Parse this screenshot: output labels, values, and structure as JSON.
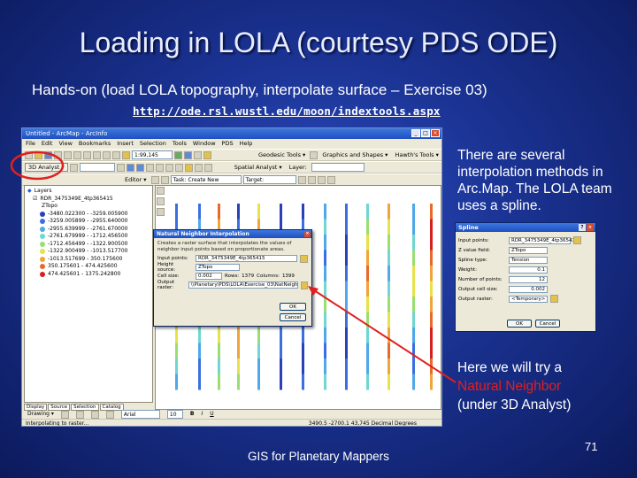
{
  "slide": {
    "title": "Loading in LOLA (courtesy PDS ODE)",
    "subtitle": "Hands-on (load LOLA topography, interpolate surface – Exercise 03)",
    "url": "http://ode.rsl.wustl.edu/moon/indextools.aspx",
    "note1": "There are several interpolation methods in Arc.Map. The LOLA team uses a spline.",
    "note2_pre": "Here we will try a",
    "note2_highlight": "Natural Neighbor",
    "note2_post": "(under 3D Analyst)",
    "footer": "GIS for Planetary Mappers",
    "page_number": "71",
    "highlight_color": "#e02020"
  },
  "arcmap": {
    "window_title": "Untitled - ArcMap - ArcInfo",
    "menu": [
      "File",
      "Edit",
      "View",
      "Bookmarks",
      "Insert",
      "Selection",
      "Tools",
      "Window",
      "PDS",
      "Help"
    ],
    "toolbar": {
      "analyst_drop": "3D Analyst ▾",
      "scale": "1:99,145",
      "geodesic": "Geodesic Tools ▾",
      "graphics": "Graphics and Shapes ▾",
      "hawths": "Hawth's Tools ▾",
      "editor": "Editor ▾",
      "task": "Task: Create New Feature",
      "target": "Target:",
      "spatial_analyst": "Spatial Analyst ▾",
      "layer": "Layer:"
    },
    "toc": {
      "root": "Layers",
      "layer_name": "RDR_3475349E_4tp365415",
      "field": "ZTopo",
      "classes": [
        {
          "label": "-3480.022300 - -3259.005900",
          "color": "#2a3fb8"
        },
        {
          "label": "-3259.005899 - -2955.640000",
          "color": "#3b6fe0"
        },
        {
          "label": "-2955.639999 - -2761.670000",
          "color": "#4fa8e8"
        },
        {
          "label": "-2761.679999 - -1712.456500",
          "color": "#6fd6d0"
        },
        {
          "label": "-1712.456499 - -1322.900500",
          "color": "#9ade72"
        },
        {
          "label": "-1322.900499 - -1013.517700",
          "color": "#e6e24a"
        },
        {
          "label": "-1013.517699 - 350.175600",
          "color": "#f0a43a"
        },
        {
          "label": "350.175601 - 474.425600",
          "color": "#e86a2a"
        },
        {
          "label": "474.425601 - 1375.242800",
          "color": "#d62020"
        }
      ],
      "tabs": [
        "Display",
        "Source",
        "Selection",
        "Catalog"
      ]
    },
    "drawing": "Drawing ▾",
    "font": "Arial",
    "font_size": "10",
    "status": "Interpolating to raster...",
    "coords": "3490.5 -2700.1 43,745 Decimal Degrees"
  },
  "nn_dialog": {
    "title": "Natural Neighbor Interpolation",
    "description": "Creates a raster surface that interpolates the values of neighbor input points based on proportionate areas.",
    "input_points_label": "Input points:",
    "input_points_value": "RDR_3475349E_4tp365415",
    "height_source_label": "Height source:",
    "height_source_value": "ZTopo",
    "cell_size_label": "Cell size:",
    "cell_size_value": "0.002",
    "rows_label": "Rows:",
    "rows_value": "1379",
    "columns_label": "Columns:",
    "columns_value": "1399",
    "output_label": "Output raster:",
    "output_value": "\\\\Planetary\\PDS\\LOLA\\Exercise_03\\NatNeigh",
    "ok": "OK",
    "cancel": "Cancel"
  },
  "spline_dialog": {
    "title": "Spline",
    "fields": [
      {
        "label": "Input points:",
        "value": "RDR_3475349E_4tp365415"
      },
      {
        "label": "Z value field:",
        "value": "ZTopo"
      },
      {
        "label": "Spline type:",
        "value": "Tension"
      },
      {
        "label": "Weight:",
        "value": "0.1"
      },
      {
        "label": "Number of points:",
        "value": "12"
      },
      {
        "label": "Output cell size:",
        "value": "0.002"
      },
      {
        "label": "Output raster:",
        "value": "<Temporary>"
      }
    ],
    "ok": "OK",
    "cancel": "Cancel"
  }
}
